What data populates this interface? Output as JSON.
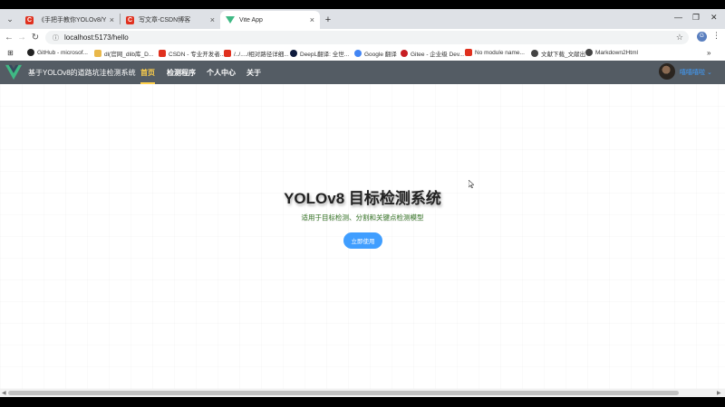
{
  "browser": {
    "tabs": [
      {
        "label": "《手把手教你YOLOv8/YOLOv...",
        "favicon": "csdn-icon"
      },
      {
        "label": "写文章-CSDN博客",
        "favicon": "csdn-icon"
      },
      {
        "label": "Vite App",
        "favicon": "vite-vue-icon"
      }
    ],
    "url": "localhost:5173/hello",
    "profile_initial": "G",
    "bookmarks": [
      {
        "label": "GitHub - microsof..."
      },
      {
        "label": "dl(官网_dlib库_D..."
      },
      {
        "label": "CSDN - 专业开发者..."
      },
      {
        "label": "/../..../相对路径详细..."
      },
      {
        "label": "DeepL翻译: 全世..."
      },
      {
        "label": "Google 翻译"
      },
      {
        "label": "Gitee - 企业级 Dev..."
      },
      {
        "label": "No module name..."
      },
      {
        "label": "文献下载_文献出"
      },
      {
        "label": "Markdown2Html"
      }
    ],
    "more_bookmarks": "»"
  },
  "app": {
    "title": "基于YOLOv8的道路坑洼检测系统",
    "menu": [
      {
        "label": "首页",
        "active": true
      },
      {
        "label": "检测程序",
        "active": false
      },
      {
        "label": "个人中心",
        "active": false
      },
      {
        "label": "关于",
        "active": false
      }
    ],
    "username": "嘻嘻嘻啦"
  },
  "hero": {
    "title": "YOLOv8 目标检测系统",
    "subtitle": "适用于目标检测、分割和关键点检测模型",
    "button_label": "立即使用"
  },
  "colors": {
    "navbar_bg": "#545c64",
    "menu_active": "#ffd04b",
    "primary": "#409eff",
    "vue_green": "#3fb984"
  }
}
